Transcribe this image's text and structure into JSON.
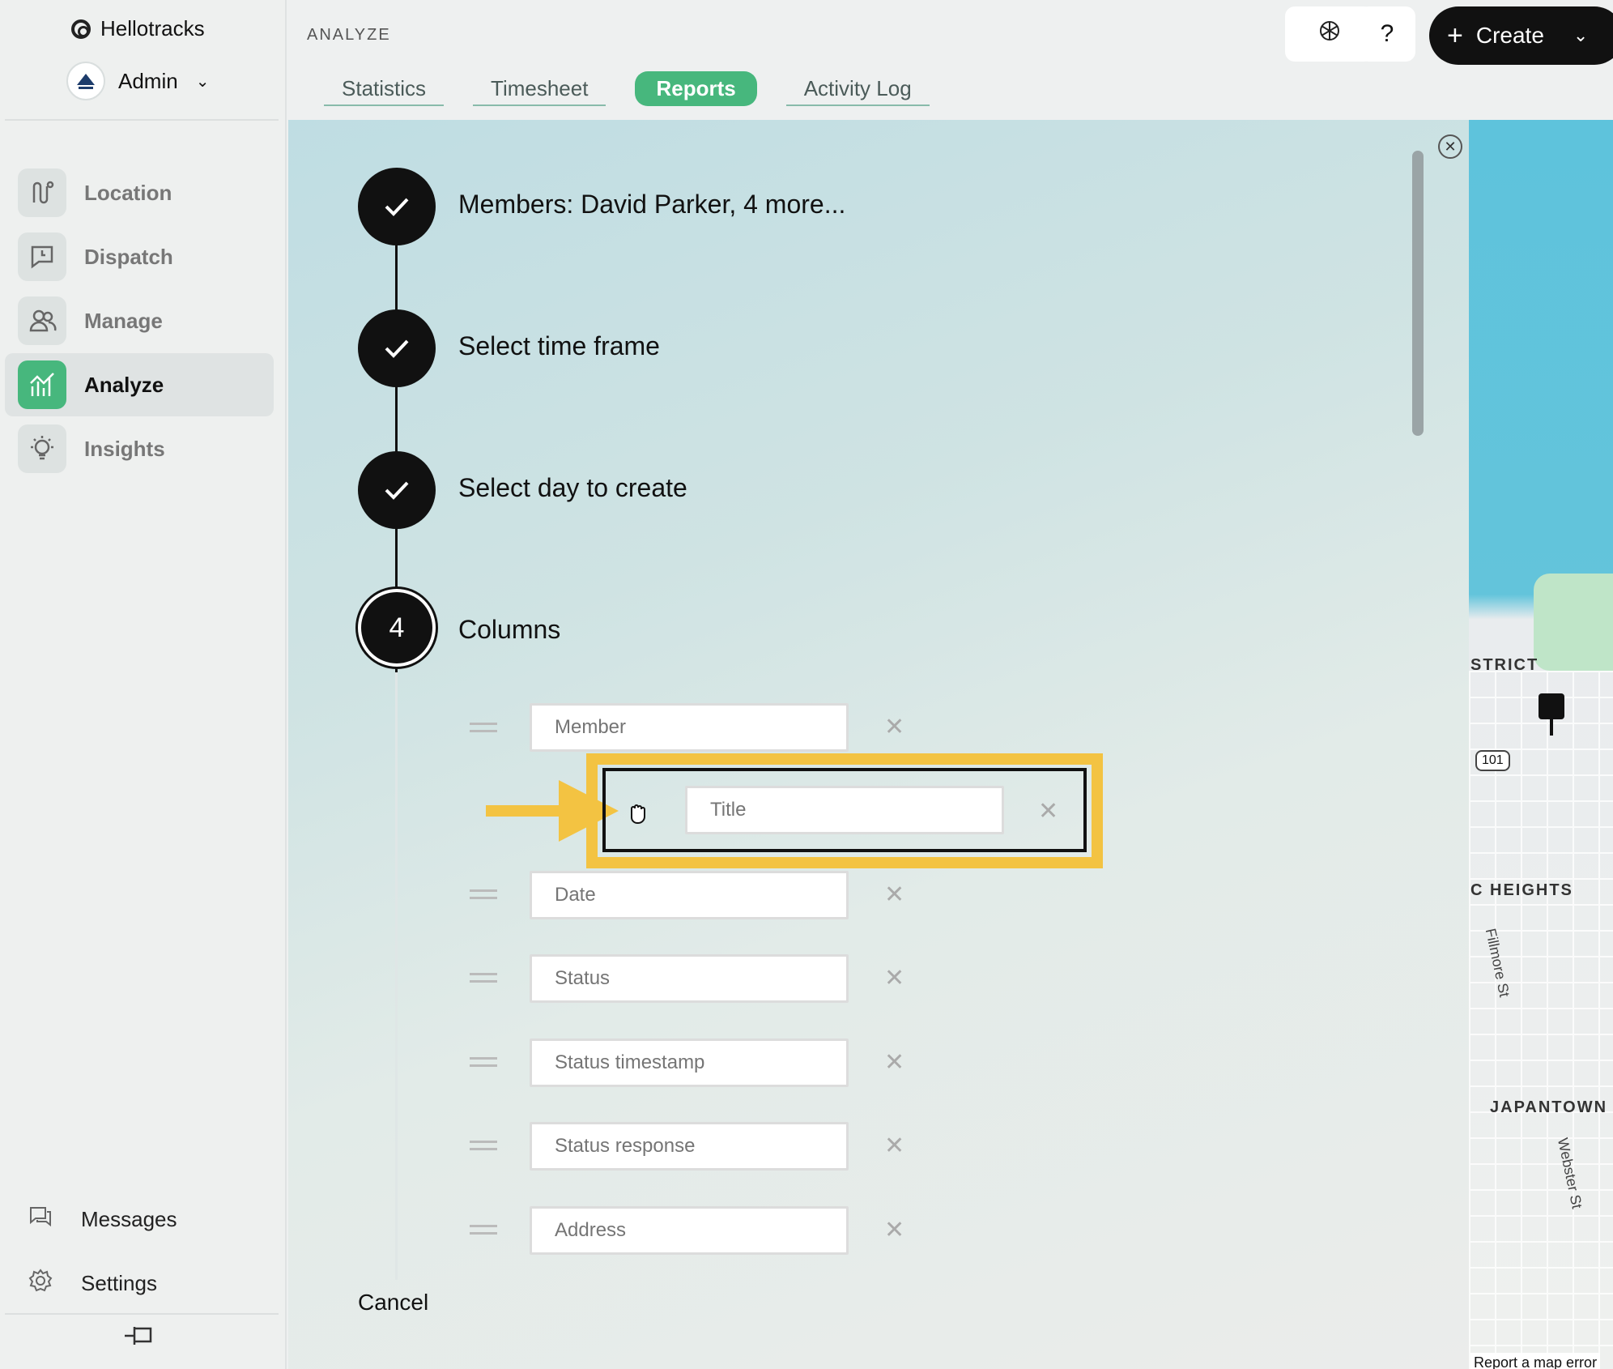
{
  "brand": {
    "name": "Hellotracks"
  },
  "account": {
    "role": "Admin"
  },
  "sidebar": {
    "items": [
      {
        "label": "Location",
        "icon": "location-icon"
      },
      {
        "label": "Dispatch",
        "icon": "dispatch-icon"
      },
      {
        "label": "Manage",
        "icon": "manage-icon"
      },
      {
        "label": "Analyze",
        "icon": "analyze-icon",
        "active": true
      },
      {
        "label": "Insights",
        "icon": "insights-icon"
      }
    ],
    "bottom": [
      {
        "label": "Messages",
        "icon": "messages-icon"
      },
      {
        "label": "Settings",
        "icon": "settings-icon"
      }
    ]
  },
  "header": {
    "section": "ANALYZE",
    "tabs": [
      "Statistics",
      "Timesheet",
      "Reports",
      "Activity Log"
    ],
    "active_tab": "Reports",
    "help_label": "?",
    "create_label": "Create"
  },
  "wizard": {
    "steps": [
      {
        "title": "Members: David Parker, 4 more...",
        "done": true
      },
      {
        "title": "Select time frame",
        "done": true
      },
      {
        "title": "Select day to create",
        "done": true
      },
      {
        "title": "Columns",
        "number": "4",
        "current": true
      }
    ],
    "columns": [
      "Member",
      "Title",
      "Date",
      "Status",
      "Status timestamp",
      "Status response",
      "Address"
    ],
    "dragging_column": "Title",
    "cancel_label": "Cancel"
  },
  "map": {
    "labels": [
      "STRICT",
      "C HEIGHTS",
      "JAPANTOWN"
    ],
    "streets": [
      "Fillmore St",
      "Webster St"
    ],
    "highway": "101",
    "error_link": "Report a map error"
  },
  "colors": {
    "accent": "#47b77d",
    "highlight": "#f3c342"
  }
}
